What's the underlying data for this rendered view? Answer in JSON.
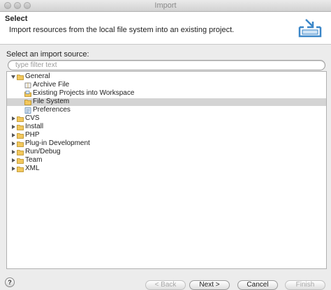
{
  "window": {
    "title": "Import"
  },
  "header": {
    "title": "Select",
    "description": "Import resources from the local file system into an existing project.",
    "icon": "import-tray-icon"
  },
  "source": {
    "label": "Select an import source:",
    "filter_placeholder": "type filter text",
    "filter_value": ""
  },
  "tree": {
    "items": [
      {
        "label": "General",
        "level": 0,
        "expanded": true,
        "icon": "folder-icon"
      },
      {
        "label": "Archive File",
        "level": 1,
        "icon": "archive-file-icon"
      },
      {
        "label": "Existing Projects into Workspace",
        "level": 1,
        "icon": "existing-projects-icon"
      },
      {
        "label": "File System",
        "level": 1,
        "icon": "folder-icon",
        "selected": true
      },
      {
        "label": "Preferences",
        "level": 1,
        "icon": "preferences-icon"
      },
      {
        "label": "CVS",
        "level": 0,
        "expanded": false,
        "icon": "folder-icon"
      },
      {
        "label": "Install",
        "level": 0,
        "expanded": false,
        "icon": "folder-icon"
      },
      {
        "label": "PHP",
        "level": 0,
        "expanded": false,
        "icon": "folder-icon"
      },
      {
        "label": "Plug-in Development",
        "level": 0,
        "expanded": false,
        "icon": "folder-icon"
      },
      {
        "label": "Run/Debug",
        "level": 0,
        "expanded": false,
        "icon": "folder-icon"
      },
      {
        "label": "Team",
        "level": 0,
        "expanded": false,
        "icon": "folder-icon"
      },
      {
        "label": "XML",
        "level": 0,
        "expanded": false,
        "icon": "folder-icon"
      }
    ]
  },
  "buttons": {
    "help": "?",
    "back": "< Back",
    "next": "Next >",
    "cancel": "Cancel",
    "finish": "Finish"
  },
  "colors": {
    "selection": "#d4d4d4",
    "folder": "#e8b84a",
    "accent_blue": "#3a86c8"
  }
}
